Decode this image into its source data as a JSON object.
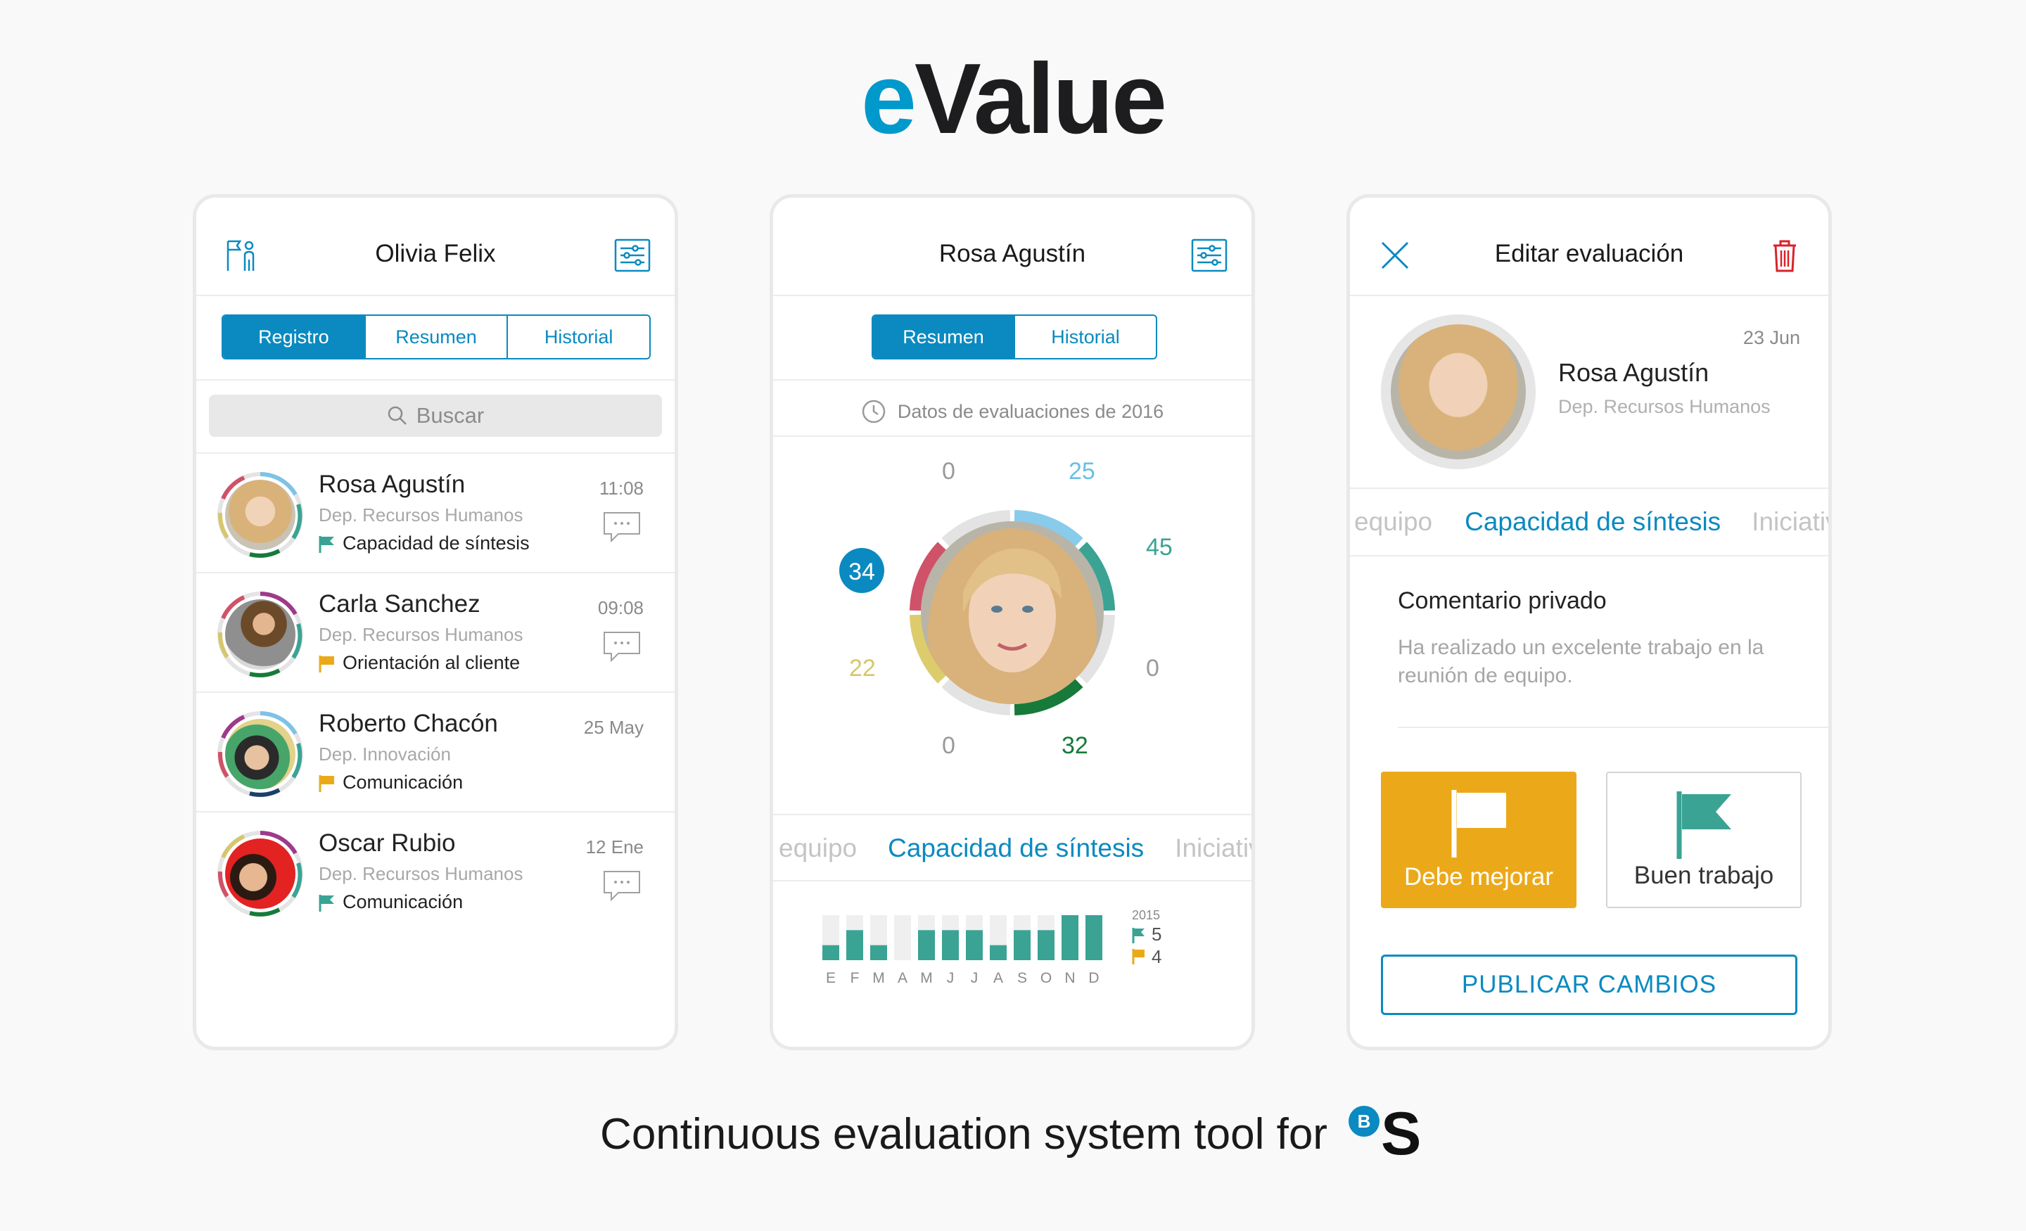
{
  "app_logo": {
    "prefix": "e",
    "rest": "Value"
  },
  "colors": {
    "accent": "#0a8ac0",
    "teal": "#3aa394",
    "yellow": "#eba91a",
    "red": "#d9222a",
    "green": "#167a3a"
  },
  "screen1": {
    "title": "Olivia Felix",
    "tabs": [
      "Registro",
      "Resumen",
      "Historial"
    ],
    "search_placeholder": "Buscar",
    "people": [
      {
        "name": "Rosa Agustín",
        "dept": "Dep. Recursos Humanos",
        "tag": "Capacidad de síntesis",
        "flag": "green",
        "time": "11:08",
        "chat": true
      },
      {
        "name": "Carla Sanchez",
        "dept": "Dep. Recursos Humanos",
        "tag": "Orientación al cliente",
        "flag": "yellow",
        "time": "09:08",
        "chat": true
      },
      {
        "name": "Roberto Chacón",
        "dept": "Dep. Innovación",
        "tag": "Comunicación",
        "flag": "yellow",
        "time": "25 May",
        "chat": false
      },
      {
        "name": "Oscar Rubio",
        "dept": "Dep. Recursos Humanos",
        "tag": "Comunicación",
        "flag": "green",
        "time": "12 Ene",
        "chat": true
      }
    ]
  },
  "screen2": {
    "title": "Rosa Agustín",
    "tabs": [
      "Resumen",
      "Historial"
    ],
    "info": "Datos de evaluaciones de 2016",
    "ring_values": {
      "top_left": "0",
      "top_right": "25",
      "right_top": "45",
      "right_bottom": "0",
      "bottom_right": "32",
      "bottom_left": "0",
      "left_bottom": "22",
      "left_top": "34"
    },
    "categories": {
      "prev": "equipo",
      "active": "Capacidad de síntesis",
      "next": "Iniciativ"
    },
    "chart_data": {
      "type": "bar",
      "categories": [
        "E",
        "F",
        "M",
        "A",
        "M",
        "J",
        "J",
        "A",
        "S",
        "O",
        "N",
        "D"
      ],
      "values": [
        1,
        2,
        1,
        0,
        2,
        2,
        2,
        1,
        2,
        2,
        3,
        3
      ],
      "ylim": [
        0,
        3
      ],
      "year": "2015",
      "legend": [
        {
          "flag": "green",
          "value": "5"
        },
        {
          "flag": "yellow",
          "value": "4"
        }
      ]
    }
  },
  "screen3": {
    "title": "Editar evaluación",
    "date": "23 Jun",
    "name": "Rosa Agustín",
    "dept": "Dep. Recursos Humanos",
    "categories": {
      "prev": "equipo",
      "active": "Capacidad de síntesis",
      "next": "Iniciativ"
    },
    "comment_title": "Comentario privado",
    "comment": "Ha realizado un excelente trabajo en la reunión de equipo.",
    "btn_improve": "Debe mejorar",
    "btn_good": "Buen trabajo",
    "btn_publish": "PUBLICAR CAMBIOS"
  },
  "footer": {
    "text": "Continuous evaluation system tool for",
    "brand_small": "B",
    "brand_big": "S"
  }
}
